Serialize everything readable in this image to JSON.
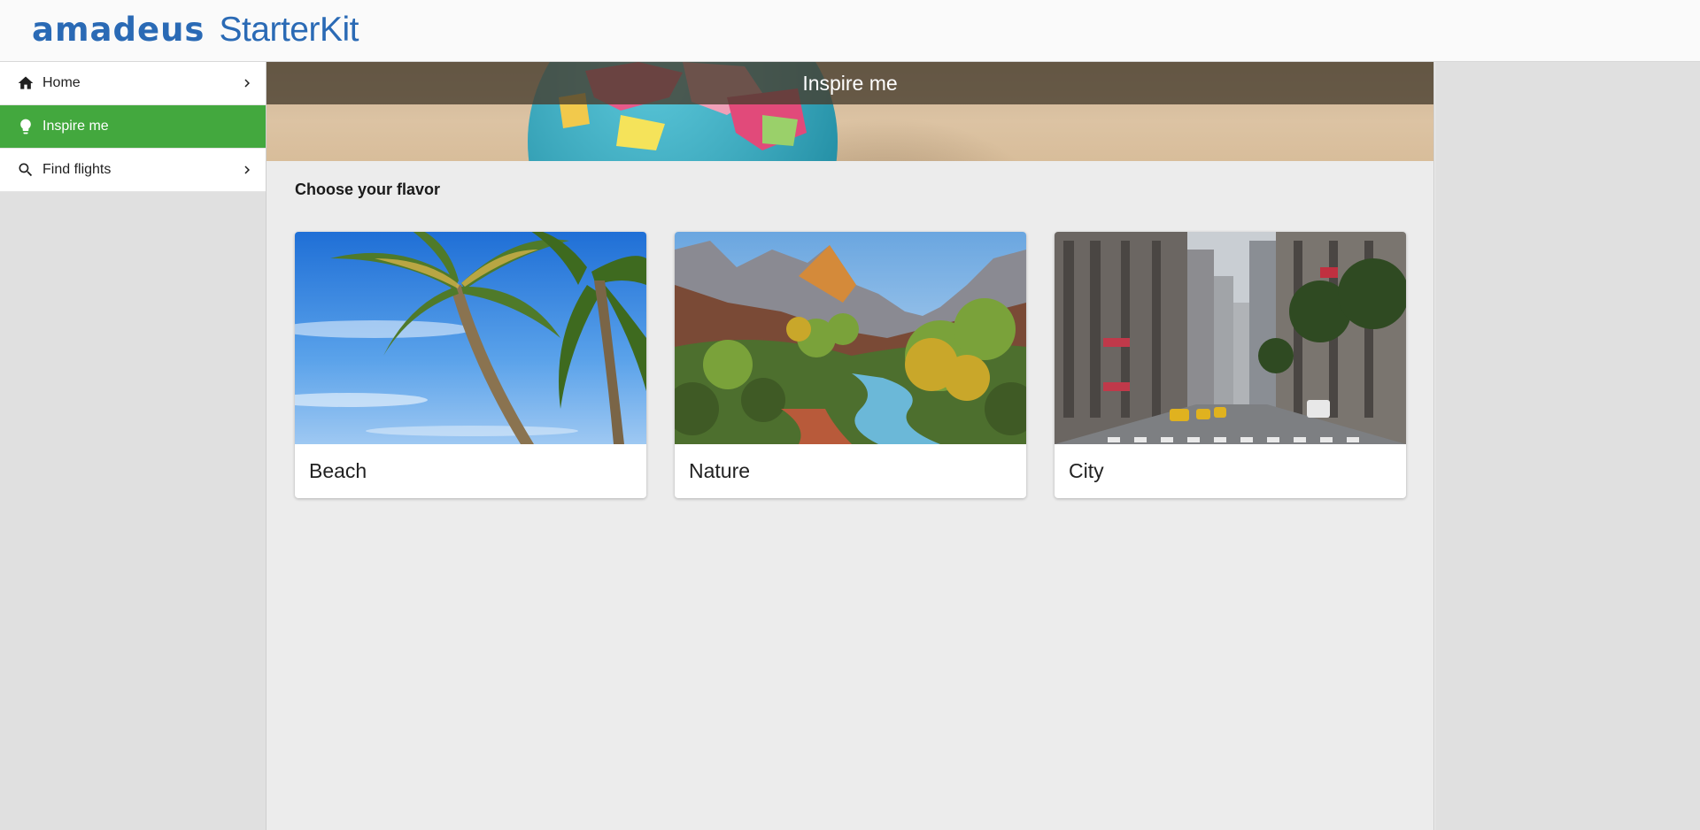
{
  "header": {
    "brand": "amadeus",
    "product": "StarterKit"
  },
  "sidebar": {
    "items": [
      {
        "label": "Home",
        "icon": "home-icon",
        "active": false
      },
      {
        "label": "Inspire me",
        "icon": "lightbulb-icon",
        "active": true
      },
      {
        "label": "Find flights",
        "icon": "search-icon",
        "active": false
      }
    ]
  },
  "page": {
    "title": "Inspire me",
    "section_title": "Choose your flavor"
  },
  "cards": [
    {
      "label": "Beach",
      "image": "beach-photo"
    },
    {
      "label": "Nature",
      "image": "nature-photo"
    },
    {
      "label": "City",
      "image": "city-photo"
    }
  ],
  "colors": {
    "brand": "#2a6ab5",
    "active_nav": "#43a83e"
  }
}
